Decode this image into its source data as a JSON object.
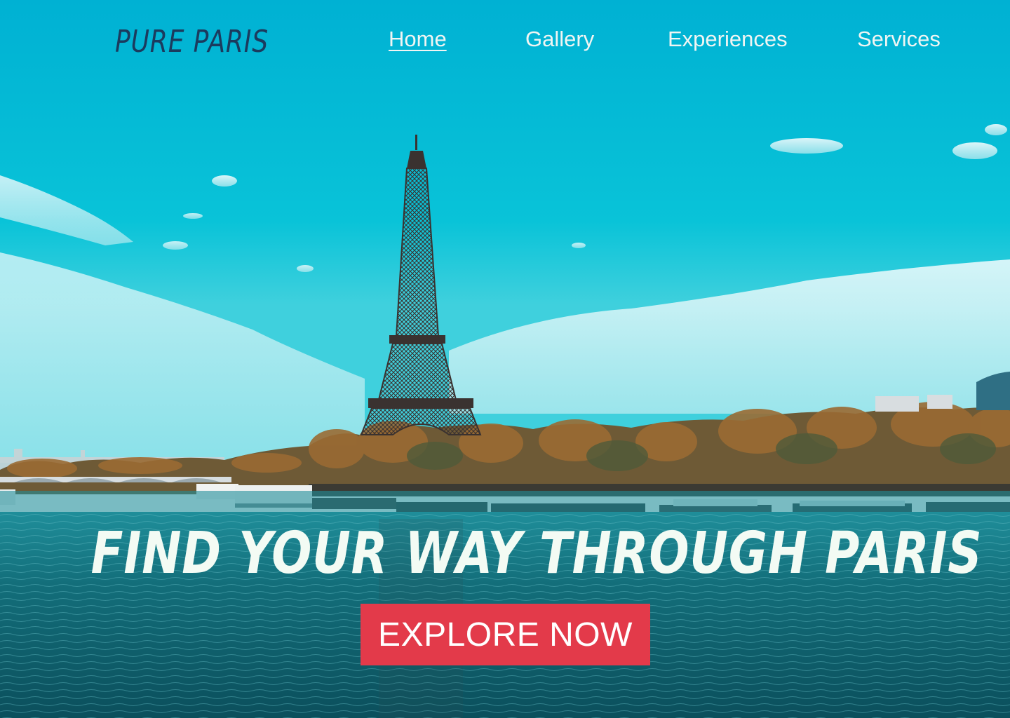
{
  "header": {
    "logo": "PURE PARIS",
    "nav": [
      {
        "label": "Home",
        "active": true
      },
      {
        "label": "Gallery",
        "active": false
      },
      {
        "label": "Experiences",
        "active": false
      },
      {
        "label": "Services",
        "active": false
      }
    ]
  },
  "hero": {
    "headline": "FIND YOUR WAY THROUGH PARIS",
    "cta_label": "EXPLORE NOW",
    "background": "eiffel-tower-seine-river-photo"
  },
  "colors": {
    "sky": "#00b4d4",
    "water": "#0f6f7c",
    "logo": "#1b3b5e",
    "nav_text": "#f1f5f3",
    "headline": "#f3fbf4",
    "cta_background": "#e33a4a",
    "cta_text": "#ffffff"
  }
}
